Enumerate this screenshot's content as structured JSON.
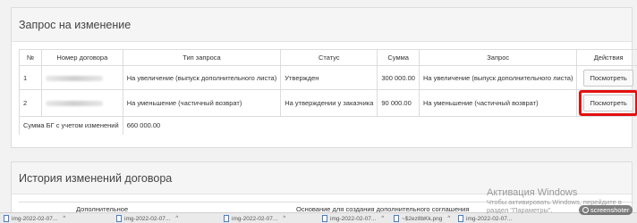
{
  "request_panel": {
    "title": "Запрос на изменение",
    "columns": [
      "№",
      "Номер договора",
      "Тип запроса",
      "Статус",
      "Сумма",
      "Запрос",
      "Действия"
    ],
    "rows": [
      {
        "num": "1",
        "type": "На увеличение (выпуск дополнительного листа)",
        "status": "Утвержден",
        "sum": "300 000.00",
        "request": "На увеличение (выпуск дополнительного листа)",
        "action": "Посмотреть"
      },
      {
        "num": "2",
        "type": "На уменьшение (частичный возврат)",
        "status": "На утверждении у заказчика",
        "sum": "90 000.00",
        "request": "На уменьшение (частичный возврат)",
        "action": "Посмотреть"
      }
    ],
    "total_label": "Сумма БГ с учетом изменений",
    "total_value": "660 000.00",
    "highlight_color": "#e31010"
  },
  "history_panel": {
    "title": "История изменений договора",
    "col_partial_1": "Дополнительное",
    "col_partial_2": "Основание для создания дополнительного соглашения"
  },
  "taskbar": {
    "items": [
      "img-2022-02-07...",
      "img-2022-02-07...",
      "img-2022-02-07...",
      "img-2022-02-07...",
      "~$2ez8bKk.png",
      "img-2022-02-07..."
    ]
  },
  "watermark": {
    "title": "Активация Windows",
    "line1": "Чтобы активировать Windows, перейдите в",
    "line2": "раздел \"Параметры\".",
    "badge": "screenshoter"
  }
}
